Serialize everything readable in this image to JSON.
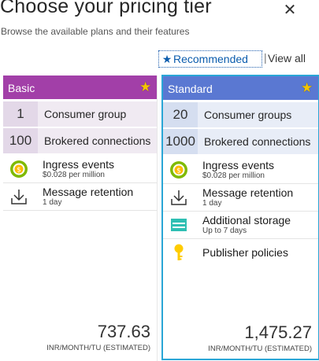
{
  "header": {
    "title": "Choose your pricing tier",
    "subtitle": "Browse the available plans and their features",
    "close_icon": "close-icon"
  },
  "filters": {
    "recommended": "Recommended",
    "separator": "|",
    "view_all": "View all"
  },
  "tiers": [
    {
      "name": "Basic",
      "accent": "#a23fa8",
      "counts": [
        {
          "value": "1",
          "label": "Consumer group"
        },
        {
          "value": "100",
          "label": "Brokered connections"
        }
      ],
      "features": [
        {
          "icon": "ingress-icon",
          "name": "Ingress events",
          "detail": "$0.028 per million"
        },
        {
          "icon": "download-icon",
          "name": "Message retention",
          "detail": "1 day"
        }
      ],
      "price": "737.63",
      "unit": "INR/MONTH/TU (ESTIMATED)"
    },
    {
      "name": "Standard",
      "accent": "#5a78d2",
      "counts": [
        {
          "value": "20",
          "label": "Consumer groups"
        },
        {
          "value": "1000",
          "label": "Brokered connections"
        }
      ],
      "features": [
        {
          "icon": "ingress-icon",
          "name": "Ingress events",
          "detail": "$0.028 per million"
        },
        {
          "icon": "download-icon",
          "name": "Message retention",
          "detail": "1 day"
        },
        {
          "icon": "storage-icon",
          "name": "Additional storage",
          "detail": "Up to 7 days"
        },
        {
          "icon": "key-icon",
          "name": "Publisher policies",
          "detail": ""
        }
      ],
      "price": "1,475.27",
      "unit": "INR/MONTH/TU (ESTIMATED)"
    }
  ]
}
